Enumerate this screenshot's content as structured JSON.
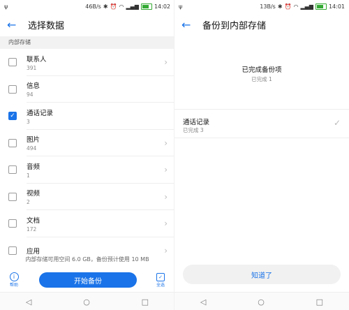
{
  "left": {
    "status": {
      "speed": "46B/s",
      "time": "14:02"
    },
    "title": "选择数据",
    "section": "内部存储",
    "items": [
      {
        "label": "联系人",
        "count": "391",
        "checked": false
      },
      {
        "label": "信息",
        "count": "94",
        "checked": false
      },
      {
        "label": "通话记录",
        "count": "3",
        "checked": true
      },
      {
        "label": "图片",
        "count": "494",
        "checked": false
      },
      {
        "label": "音频",
        "count": "1",
        "checked": false
      },
      {
        "label": "视频",
        "count": "2",
        "checked": false
      },
      {
        "label": "文档",
        "count": "172",
        "checked": false
      },
      {
        "label": "应用",
        "count": "",
        "checked": false
      }
    ],
    "storage_note": "内部存储可用空间 6.0 GB，备份预计使用 10 MB",
    "help_label": "帮助",
    "start_button": "开始备份",
    "select_all_label": "全选"
  },
  "right": {
    "status": {
      "speed": "13B/s",
      "time": "14:01"
    },
    "title": "备份到内部存储",
    "done_title": "已完成备份项",
    "done_count": "已完成 1",
    "result_item": {
      "label": "通话记录",
      "count": "已完成 3"
    },
    "ok_button": "知道了"
  },
  "icons": {
    "back": "back-arrow-icon",
    "chevron": "chevron-right-icon",
    "check": "check-icon",
    "help": "info-icon",
    "select_all": "select-all-icon"
  },
  "colors": {
    "accent": "#1a73e8"
  }
}
